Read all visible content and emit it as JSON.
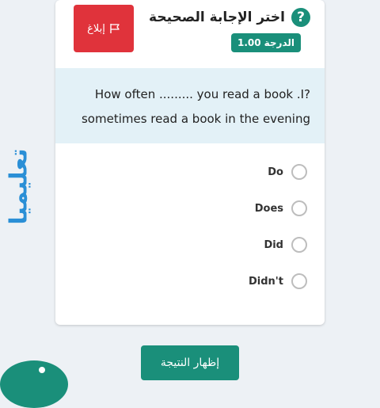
{
  "watermark": {
    "text": "تعليميا"
  },
  "card": {
    "report_label": "إبلاغ",
    "title": "اختر الإجابة الصحيحة",
    "help_glyph": "?",
    "grade_label": "الدرجة",
    "grade_value": "1.00"
  },
  "question": {
    "line1": "How often ......... you read a book .I?",
    "line2": "sometimes read a book in the evening"
  },
  "options": [
    {
      "label": "Do"
    },
    {
      "label": "Does"
    },
    {
      "label": "Did"
    },
    {
      "label": "Didn't"
    }
  ],
  "footer": {
    "show_result_label": "إظهار النتيجة"
  },
  "colors": {
    "accent": "#1a8f7a",
    "danger": "#e0333b",
    "question_bg": "#e3f1f7",
    "watermark": "#2a8fd6"
  },
  "icons": {
    "report": "flag-icon",
    "help": "question-circle-icon",
    "fab": "info-icon"
  }
}
